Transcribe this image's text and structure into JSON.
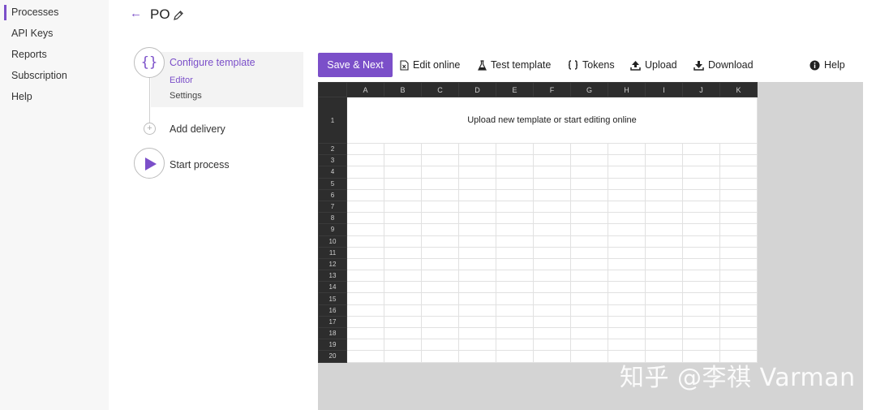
{
  "sidebar": {
    "items": [
      {
        "label": "Processes"
      },
      {
        "label": "API Keys"
      },
      {
        "label": "Reports"
      },
      {
        "label": "Subscription"
      },
      {
        "label": "Help"
      }
    ]
  },
  "header": {
    "back": "←",
    "title": "PO"
  },
  "stepper": {
    "configure": {
      "icon": "{}",
      "label": "Configure template",
      "sub": [
        "Editor",
        "Settings"
      ]
    },
    "add_delivery": {
      "icon": "+",
      "label": "Add delivery"
    },
    "start_process": {
      "label": "Start process"
    }
  },
  "toolbar": {
    "save_next": "Save & Next",
    "edit_online": "Edit online",
    "test_template": "Test template",
    "tokens": "Tokens",
    "upload": "Upload",
    "download": "Download",
    "help": "Help"
  },
  "sheet": {
    "columns": [
      "A",
      "B",
      "C",
      "D",
      "E",
      "F",
      "G",
      "H",
      "I",
      "J",
      "K"
    ],
    "rows": [
      "1",
      "2",
      "3",
      "4",
      "5",
      "6",
      "7",
      "8",
      "9",
      "10",
      "11",
      "12",
      "13",
      "14",
      "15",
      "16",
      "17",
      "18",
      "19",
      "20"
    ],
    "message": "Upload new template or start editing online"
  },
  "watermark": "知乎 @李祺 Varman",
  "colors": {
    "accent": "#7b4fc9",
    "sheet_header": "#2d2d2d",
    "sheet_bg": "#d4d4d4",
    "sidebar_bg": "#f7f7f7"
  }
}
